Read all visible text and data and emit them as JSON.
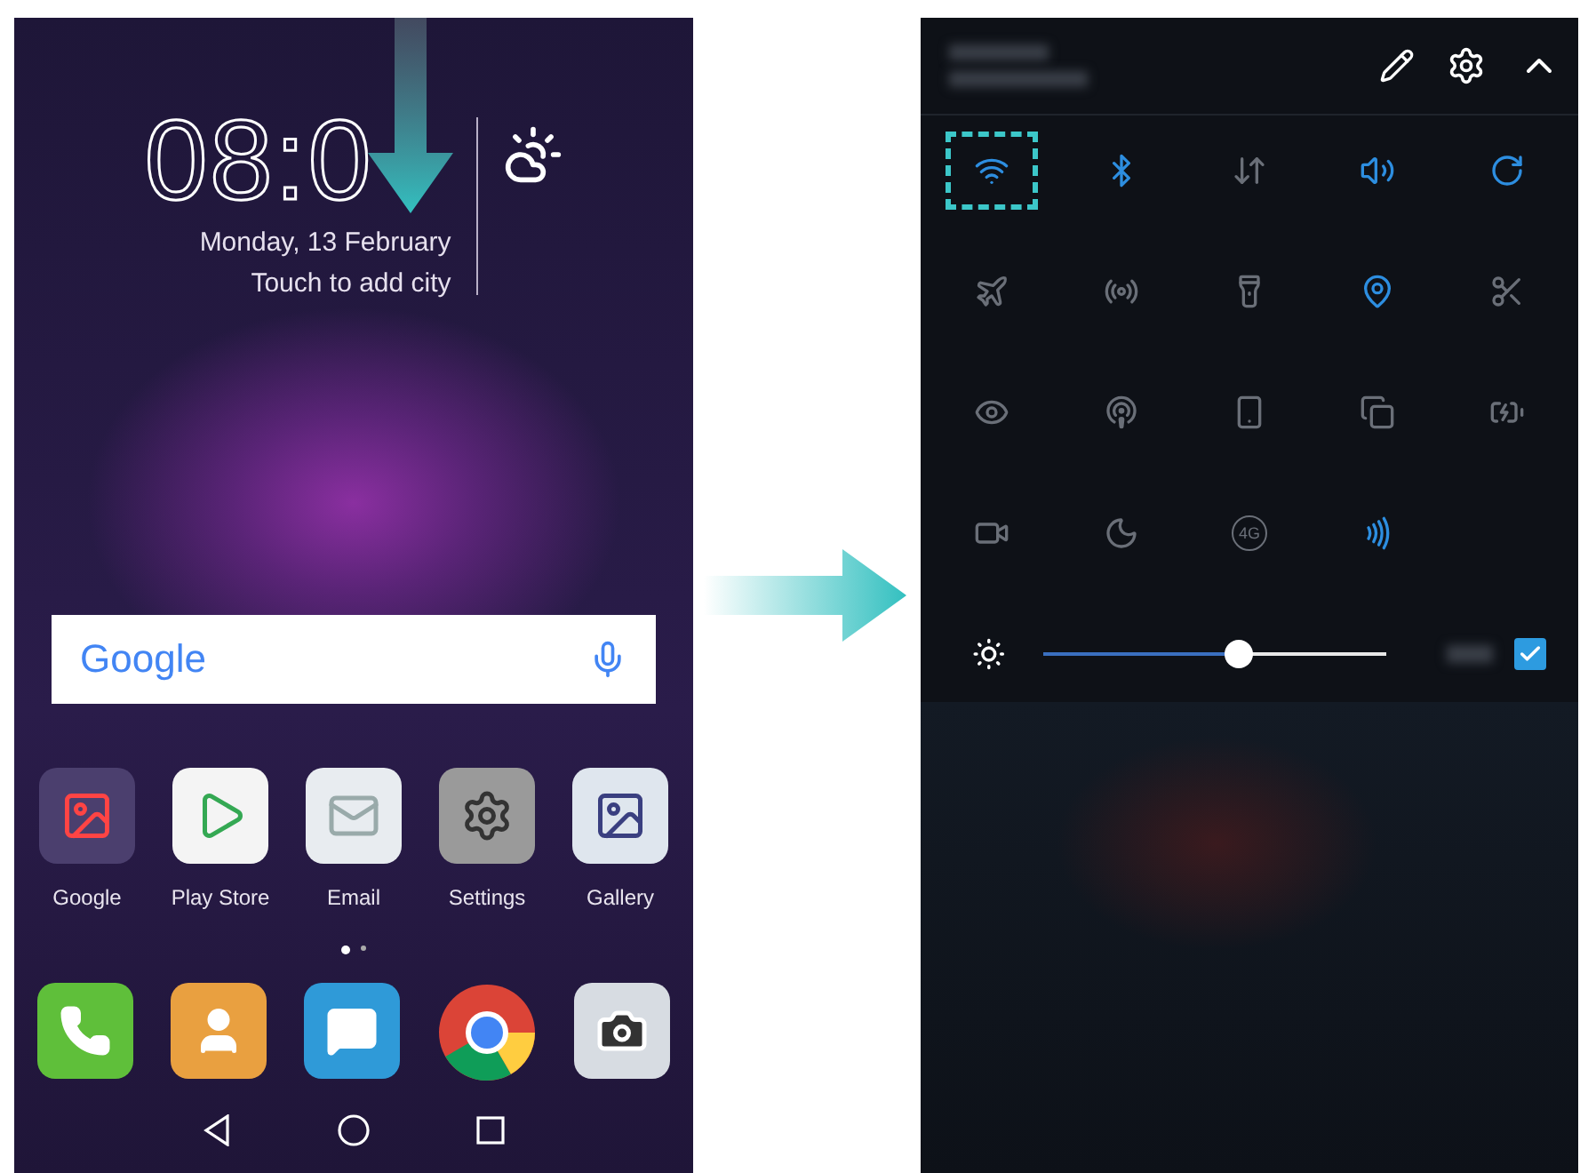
{
  "home_screen": {
    "clock": {
      "time": "08:0",
      "date": "Monday, 13 February",
      "city": "Touch to add city"
    },
    "search_bar": {
      "logo": "Google"
    },
    "apps": [
      {
        "label": "Google",
        "kind": "folder"
      },
      {
        "label": "Play Store",
        "kind": "store"
      },
      {
        "label": "Email",
        "kind": "email"
      },
      {
        "label": "Settings",
        "kind": "settings"
      },
      {
        "label": "Gallery",
        "kind": "gallery"
      }
    ],
    "page_dots": [
      {
        "selected": true
      },
      {
        "selected": false
      }
    ],
    "dock": [
      {
        "kind": "phone"
      },
      {
        "kind": "contacts"
      },
      {
        "kind": "messages"
      },
      {
        "kind": "browser"
      },
      {
        "kind": "camera"
      }
    ]
  },
  "quick_settings": {
    "tiles": [
      {
        "kind": "wifi",
        "on": true,
        "highlighted": true
      },
      {
        "kind": "bluetooth",
        "on": true,
        "highlighted": false
      },
      {
        "kind": "data",
        "on": false,
        "highlighted": false
      },
      {
        "kind": "sound",
        "on": true,
        "highlighted": false
      },
      {
        "kind": "rotate",
        "on": true,
        "highlighted": false
      },
      {
        "kind": "airplane",
        "on": false,
        "highlighted": false
      },
      {
        "kind": "hotspot",
        "on": false,
        "highlighted": false
      },
      {
        "kind": "flashlight",
        "on": false,
        "highlighted": false
      },
      {
        "kind": "location",
        "on": true,
        "highlighted": false
      },
      {
        "kind": "screenshot",
        "on": false,
        "highlighted": false
      },
      {
        "kind": "eye",
        "on": false,
        "highlighted": false
      },
      {
        "kind": "signal",
        "on": false,
        "highlighted": false
      },
      {
        "kind": "phone-side",
        "on": false,
        "highlighted": false
      },
      {
        "kind": "share",
        "on": false,
        "highlighted": false
      },
      {
        "kind": "battery",
        "on": false,
        "highlighted": false
      },
      {
        "kind": "record",
        "on": false,
        "highlighted": false
      },
      {
        "kind": "moon",
        "on": false,
        "highlighted": false
      },
      {
        "kind": "network",
        "label": "4G",
        "on": false,
        "highlighted": false
      },
      {
        "kind": "nfc",
        "on": true,
        "highlighted": false
      }
    ],
    "brightness": {
      "level": 0.57,
      "auto": true
    }
  }
}
